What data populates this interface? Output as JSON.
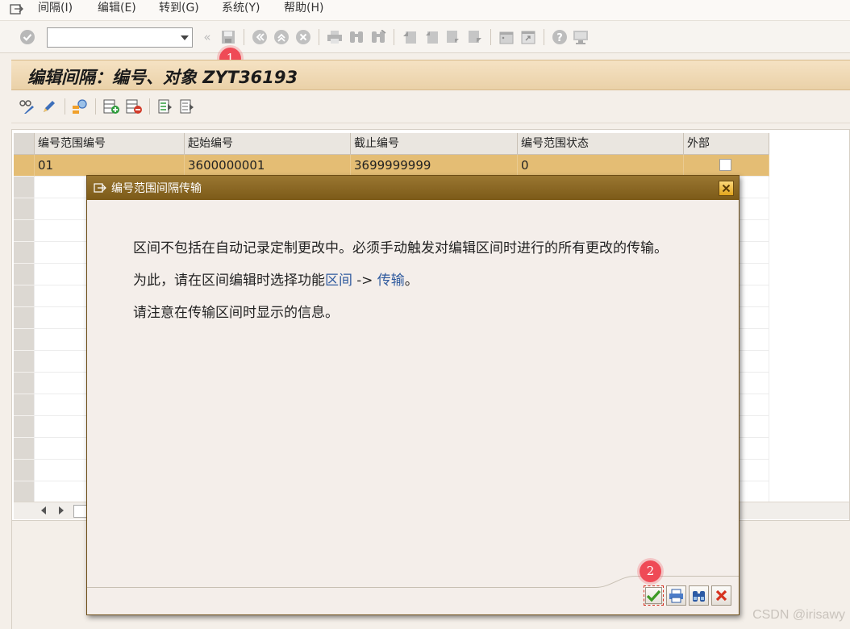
{
  "menu": {
    "items": [
      {
        "label": "间隔(I)"
      },
      {
        "label": "编辑(E)"
      },
      {
        "label": "转到(G)"
      },
      {
        "label": "系统(Y)"
      },
      {
        "label": "帮助(H)"
      }
    ]
  },
  "command_field": {
    "value": ""
  },
  "page_title": "编辑间隔：编号、对象 ZYT36193",
  "table": {
    "columns": [
      "编号范围编号",
      "起始编号",
      "截止编号",
      "编号范围状态",
      "外部"
    ],
    "rows": [
      {
        "range_no": "01",
        "from_no": "3600000001",
        "to_no": "3699999999",
        "status": "0",
        "external": false
      }
    ]
  },
  "dialog": {
    "title": "编号范围间隔传输",
    "para1": "区间不包括在自动记录定制更改中。必须手动触发对编辑区间时进行的所有更改的传输。",
    "para2_prefix": "为此，请在区间编辑时选择功能",
    "para2_link1": "区间",
    "para2_arrow": " -> ",
    "para2_link2": "传输",
    "para2_suffix": "。",
    "para3": "请注意在传输区间时显示的信息。"
  },
  "markers": {
    "m1": "1",
    "m2": "2"
  },
  "watermark": "CSDN @irisawy",
  "colors": {
    "title_gradient": "#ead1a8",
    "selected_row": "#e4bd74",
    "dialog_title": "#8a6623",
    "marker": "#ef4a56",
    "link": "#2f5a9e"
  }
}
